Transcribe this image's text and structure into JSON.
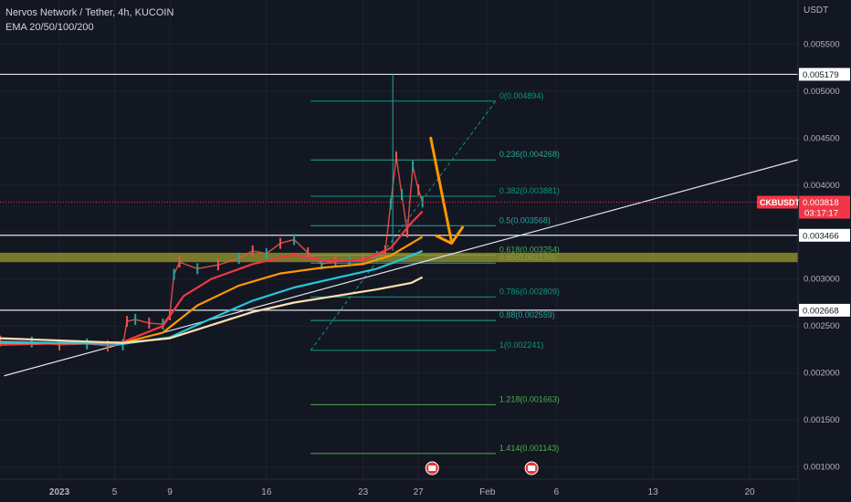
{
  "legend": {
    "title": "Nervos Network / Tether, 4h, KUCOIN",
    "indicator": "EMA 20/50/100/200"
  },
  "price_axis": {
    "unit": "USDT",
    "ticks": [
      "0.005500",
      "0.005000",
      "0.004500",
      "0.004000",
      "0.003500",
      "0.003000",
      "0.002500",
      "0.002000",
      "0.001500",
      "0.001000"
    ],
    "tick_values": [
      0.0055,
      0.005,
      0.0045,
      0.004,
      0.0035,
      0.003,
      0.0025,
      0.002,
      0.0015,
      0.001
    ],
    "boxed_labels": [
      {
        "text": "0.005179",
        "value": 0.005179
      },
      {
        "text": "0.003466",
        "value": 0.003466
      },
      {
        "text": "0.002668",
        "value": 0.002668
      }
    ],
    "current_symbol": "CKBUSDT",
    "current_price": "0.003818",
    "current_price_value": 0.003818,
    "countdown": "03:17:17",
    "current_color": "#f23645"
  },
  "time_axis": {
    "labels": [
      {
        "text": "2023",
        "d": 0,
        "bold": true
      },
      {
        "text": "5",
        "d": 4
      },
      {
        "text": "9",
        "d": 8
      },
      {
        "text": "16",
        "d": 15
      },
      {
        "text": "23",
        "d": 22
      },
      {
        "text": "27",
        "d": 26
      },
      {
        "text": "Feb",
        "d": 31
      },
      {
        "text": "6",
        "d": 36
      },
      {
        "text": "13",
        "d": 43
      },
      {
        "text": "20",
        "d": 50
      }
    ]
  },
  "fib_levels": [
    {
      "text": "0(0.004894)",
      "value": 0.004894,
      "color": "#089981"
    },
    {
      "text": "0.236(0.004268)",
      "value": 0.004268,
      "color": "#22ab94"
    },
    {
      "text": "0.382(0.003881)",
      "value": 0.003881,
      "color": "#089981"
    },
    {
      "text": "0.5(0.003568)",
      "value": 0.003568,
      "color": "#26a69a"
    },
    {
      "text": "0.618(0.003254)",
      "value": 0.003254,
      "color": "#4caf50"
    },
    {
      "text": "0.65(0.003170)",
      "value": 0.00317,
      "color": "#26a69a"
    },
    {
      "text": "0.786(0.002809)",
      "value": 0.002809,
      "color": "#089981"
    },
    {
      "text": "0.88(0.002559)",
      "value": 0.002559,
      "color": "#26a69a"
    },
    {
      "text": "1(0.002241)",
      "value": 0.002241,
      "color": "#089981"
    },
    {
      "text": "1.218(0.001663)",
      "value": 0.001663,
      "color": "#4caf50"
    },
    {
      "text": "1.414(0.001143)",
      "value": 0.001143,
      "color": "#4caf50"
    }
  ],
  "horizontal_lines": [
    0.005179,
    0.003466,
    0.002668
  ],
  "zone": {
    "from": 0.00318,
    "to": 0.00328,
    "color": "#9c9b2e"
  },
  "chart_data": {
    "type": "line",
    "title": "Nervos Network / Tether, 4h, KUCOIN",
    "xlabel": "",
    "ylabel": "USDT",
    "ylim": [
      0.00087,
      0.00597
    ],
    "xlim_days": [
      -4.3,
      53.5
    ],
    "grid": true,
    "price_path": [
      [
        -4.3,
        0.00234
      ],
      [
        -2,
        0.00233
      ],
      [
        0,
        0.0023
      ],
      [
        2,
        0.00231
      ],
      [
        3.5,
        0.00229
      ],
      [
        4.6,
        0.0023
      ],
      [
        4.9,
        0.00255
      ],
      [
        5.5,
        0.00257
      ],
      [
        6.5,
        0.00253
      ],
      [
        7.5,
        0.00252
      ],
      [
        8,
        0.00262
      ],
      [
        8.3,
        0.00305
      ],
      [
        8.7,
        0.00318
      ],
      [
        10,
        0.00311
      ],
      [
        11.5,
        0.00315
      ],
      [
        13,
        0.00322
      ],
      [
        14,
        0.0033
      ],
      [
        15,
        0.00327
      ],
      [
        16,
        0.00338
      ],
      [
        17,
        0.00342
      ],
      [
        18,
        0.00328
      ],
      [
        19,
        0.00316
      ],
      [
        20,
        0.00319
      ],
      [
        21,
        0.0032
      ],
      [
        22,
        0.00321
      ],
      [
        23,
        0.00324
      ],
      [
        23.6,
        0.0033
      ],
      [
        24,
        0.0038
      ],
      [
        24.4,
        0.0043
      ],
      [
        24.8,
        0.0039
      ],
      [
        25.2,
        0.0035
      ],
      [
        25.6,
        0.0042
      ],
      [
        26,
        0.00395
      ],
      [
        26.3,
        0.00382
      ]
    ],
    "series": [
      {
        "name": "EMA 20",
        "color": "#f23645",
        "values": [
          [
            -4.3,
            0.0023
          ],
          [
            4.6,
            0.00233
          ],
          [
            7.5,
            0.0025
          ],
          [
            9,
            0.00282
          ],
          [
            11,
            0.003
          ],
          [
            14,
            0.00316
          ],
          [
            17,
            0.00326
          ],
          [
            19,
            0.0032
          ],
          [
            22,
            0.0032
          ],
          [
            24,
            0.00333
          ],
          [
            25.5,
            0.0036
          ],
          [
            26.3,
            0.00372
          ]
        ]
      },
      {
        "name": "EMA 50",
        "color": "#ff9800",
        "values": [
          [
            -4.3,
            0.00232
          ],
          [
            4.6,
            0.00232
          ],
          [
            7.5,
            0.00243
          ],
          [
            10,
            0.00272
          ],
          [
            13,
            0.00293
          ],
          [
            16,
            0.00306
          ],
          [
            19,
            0.00312
          ],
          [
            22,
            0.00316
          ],
          [
            24,
            0.00325
          ],
          [
            26.3,
            0.00345
          ]
        ]
      },
      {
        "name": "EMA 100",
        "color": "#26c6da",
        "values": [
          [
            -4.3,
            0.00233
          ],
          [
            4.6,
            0.00231
          ],
          [
            8,
            0.00238
          ],
          [
            11,
            0.00258
          ],
          [
            14,
            0.00277
          ],
          [
            17,
            0.00291
          ],
          [
            20,
            0.00301
          ],
          [
            23,
            0.00311
          ],
          [
            25,
            0.00322
          ],
          [
            26.3,
            0.0033
          ]
        ]
      },
      {
        "name": "EMA 200",
        "color": "#ffe0b2",
        "values": [
          [
            -4.3,
            0.00237
          ],
          [
            4.6,
            0.00232
          ],
          [
            8,
            0.00237
          ],
          [
            11,
            0.00251
          ],
          [
            14,
            0.00265
          ],
          [
            17,
            0.00275
          ],
          [
            20,
            0.00282
          ],
          [
            23,
            0.00289
          ],
          [
            25.5,
            0.00296
          ],
          [
            26.3,
            0.00302
          ]
        ]
      }
    ]
  }
}
